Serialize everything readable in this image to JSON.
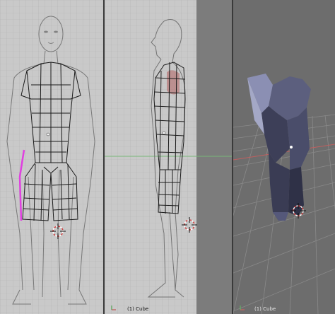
{
  "viewports": {
    "front": {
      "object_label": "",
      "axis_icon": "axis-gizmo"
    },
    "side": {
      "object_label": "(1) Cube",
      "axis_icon": "axis-gizmo"
    },
    "camera": {
      "object_label": "(1) Cube",
      "axis_icon": "axis-gizmo"
    }
  },
  "colors": {
    "grid_bg": "#c9c9c9",
    "grid_line": "#b0b0b0",
    "mesh_wire": "#1a1a1a",
    "selected_edge": "#e040e0",
    "persp_bg": "#6d6d6d",
    "persp_grid": "#8a8a8a",
    "x_axis": "#c06060",
    "y_axis": "#60c060",
    "mesh_solid": "#3d3f58",
    "mesh_solid_light": "#8b8fb3"
  }
}
